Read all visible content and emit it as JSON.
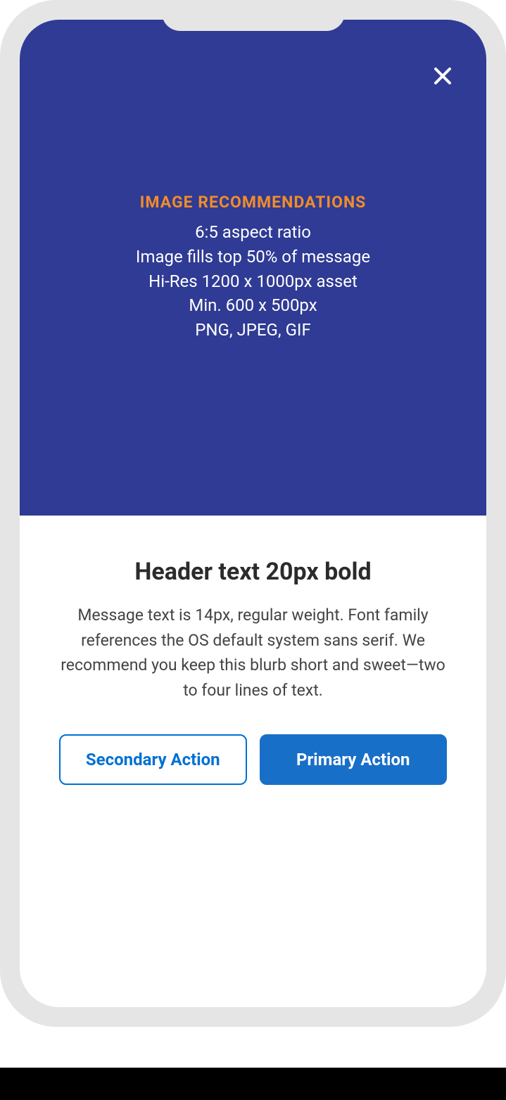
{
  "image_area": {
    "recs_title": "IMAGE RECOMMENDATIONS",
    "line1": "6:5 aspect ratio",
    "line2": "Image fills top 50% of message",
    "line3": "Hi-Res 1200 x 1000px asset",
    "line4": "Min. 600 x 500px",
    "line5": "PNG, JPEG, GIF"
  },
  "content": {
    "header": "Header text 20px bold",
    "message": "Message text is 14px, regular weight. Font family references the OS default system sans serif. We recommend you keep this blurb short and sweet—two to four lines of text."
  },
  "buttons": {
    "secondary": "Secondary Action",
    "primary": "Primary Action"
  },
  "colors": {
    "image_bg": "#2f3b94",
    "accent_orange": "#f28c28",
    "primary_blue": "#186fc8",
    "link_blue": "#0070d2"
  }
}
